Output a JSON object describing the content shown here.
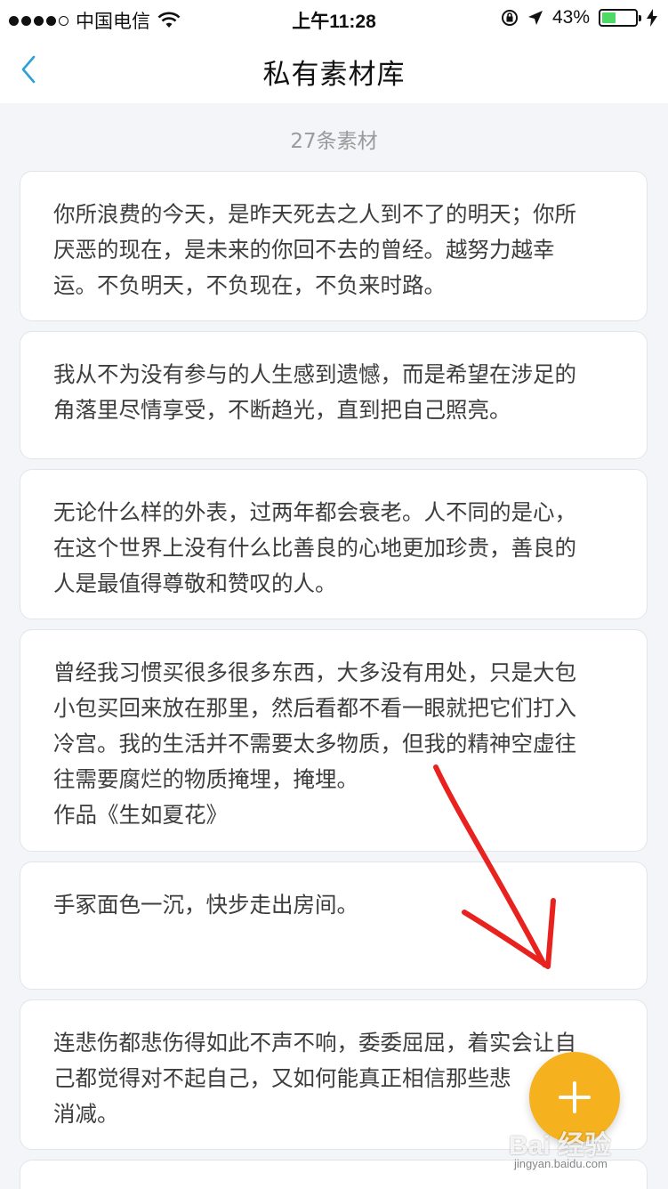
{
  "status_bar": {
    "carrier": "中国电信",
    "time": "上午11:28",
    "battery_percent": "43%",
    "battery_level": 0.43,
    "battery_color": "#4cd964"
  },
  "nav": {
    "back_icon": "chevron-left-icon",
    "title": "私有素材库",
    "accent_color": "#2b9fd9"
  },
  "list": {
    "count_label": "27条素材",
    "items": [
      {
        "lines": [
          "你所浪费的今天，是昨天死去之人到不了的明天；你所",
          "厌恶的现在，是未来的你回不去的曾经。越努力越幸",
          "运。不负明天，不负现在，不负来时路。"
        ]
      },
      {
        "lines": [
          "我从不为没有参与的人生感到遗憾，而是希望在涉足的",
          "角落里尽情享受，不断趋光，直到把自己照亮。"
        ]
      },
      {
        "lines": [
          "无论什么样的外表，过两年都会衰老。人不同的是心，",
          "在这个世界上没有什么比善良的心地更加珍贵，善良的",
          "人是最值得尊敬和赞叹的人。"
        ]
      },
      {
        "lines": [
          "曾经我习惯买很多很多东西，大多没有用处，只是大包",
          "小包买回来放在那里，然后看都不看一眼就把它们打入",
          "冷宫。我的生活并不需要太多物质，但我的精神空虚往",
          "往需要腐烂的物质掩埋，掩埋。",
          "作品《生如夏花》"
        ]
      },
      {
        "lines": [
          "手冢面色一沉，快步走出房间。"
        ]
      },
      {
        "lines": [
          "连悲伤都悲伤得如此不声不响，委委屈屈，着实会让自",
          "己都觉得对不起自己，又如何能真正相信那些悲",
          "消减。"
        ]
      }
    ]
  },
  "fab": {
    "icon": "plus-icon",
    "color": "#f5b21e"
  },
  "annotation": {
    "color": "#e8231f"
  },
  "watermark": {
    "logo": "Bai 经验",
    "url": "jingyan.baidu.com"
  }
}
